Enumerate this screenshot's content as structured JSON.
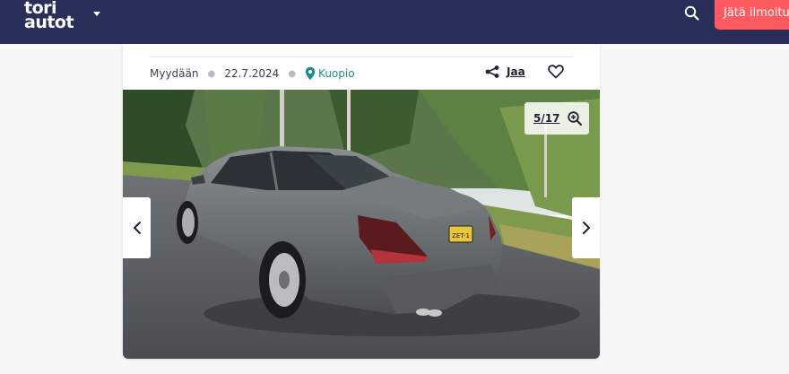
{
  "header": {
    "logo_line1": "tori",
    "logo_line2": "autot",
    "post_button_label": "Jätä ilmoitus"
  },
  "listing": {
    "status": "Myydään",
    "date": "22.7.2024",
    "location": "Kuopio",
    "share_label": "Jaa"
  },
  "gallery": {
    "counter": "5/17",
    "plate_text": "ZET-1"
  },
  "colors": {
    "header_bg": "#2a2f59",
    "accent_red": "#ff5a5f",
    "location_teal": "#1f8a95"
  }
}
